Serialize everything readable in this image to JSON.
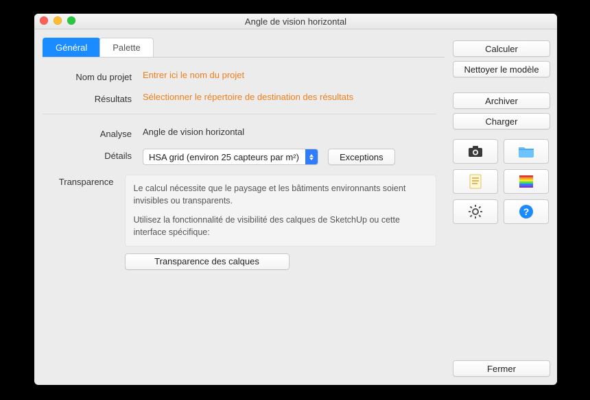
{
  "window": {
    "title": "Angle de vision horizontal"
  },
  "tabs": {
    "general": "Général",
    "palette": "Palette"
  },
  "form": {
    "project_name_label": "Nom du projet",
    "project_name_value": "Entrer ici le nom du projet",
    "results_label": "Résultats",
    "results_value": "Sélectionner le répertoire de destination des résultats",
    "analysis_label": "Analyse",
    "analysis_value": "Angle de vision horizontal",
    "details_label": "Détails",
    "details_select": "HSA grid (environ 25 capteurs par m²)",
    "exceptions_btn": "Exceptions",
    "transparency_label": "Transparence",
    "transparency_info_1": "Le calcul nécessite que le paysage et les bâtiments environnants soient invisibles ou transparents.",
    "transparency_info_2": "Utilisez la fonctionnalité de visibilité des calques de SketchUp ou cette interface spécifique:",
    "transparency_btn": "Transparence des calques"
  },
  "sidebar": {
    "compute": "Calculer",
    "clean": "Nettoyer le modèle",
    "archive": "Archiver",
    "load": "Charger",
    "close": "Fermer"
  },
  "icons": {
    "camera": "camera-icon",
    "folder": "folder-icon",
    "notes": "notes-icon",
    "palette": "palette-icon",
    "gear": "gear-icon",
    "help": "help-icon"
  }
}
